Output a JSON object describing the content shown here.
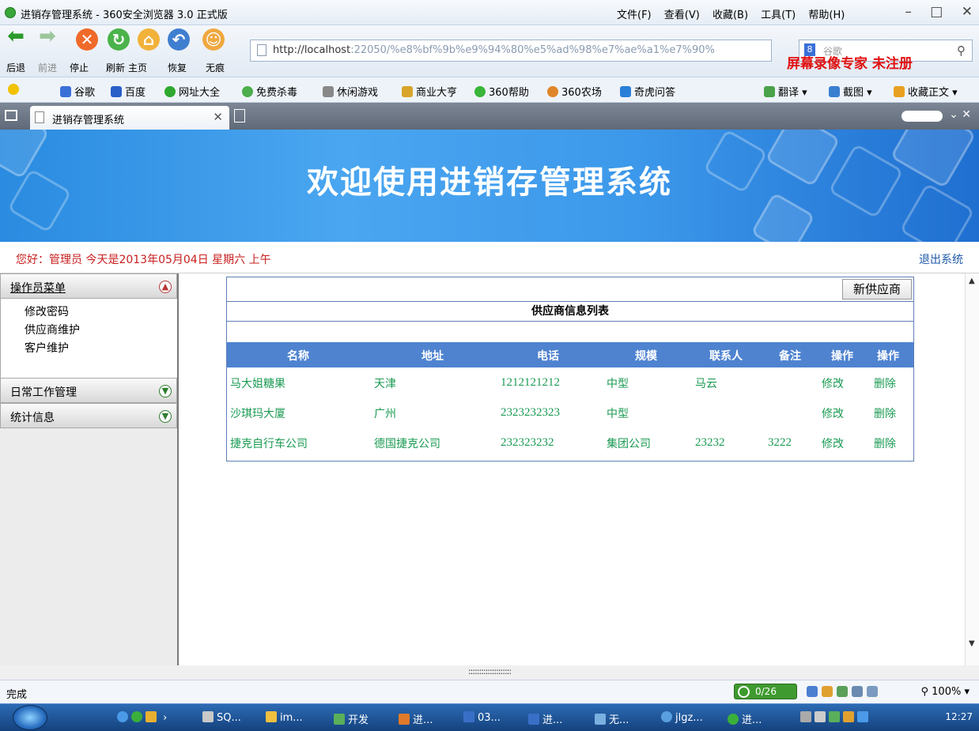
{
  "browser": {
    "window_title": "进销存管理系统 - 360安全浏览器 3.0 正式版",
    "menus": [
      "文件(F)",
      "查看(V)",
      "收藏(B)",
      "工具(T)",
      "帮助(H)"
    ],
    "nav_buttons": [
      "后退",
      "前进",
      "停止",
      "刷新",
      "主页",
      "恢复",
      "无痕"
    ],
    "address_host": "http://localhost",
    "address_rest": ":22050/%e8%bf%9b%e9%94%80%e5%ad%98%e7%ae%a1%e7%90%",
    "search_placeholder": "谷歌",
    "watermark": "屏幕录像专家  未注册",
    "favorites": [
      "谷歌",
      "百度",
      "网址大全",
      "免费杀毒",
      "休闲游戏",
      "商业大亨",
      "360帮助",
      "360农场",
      "奇虎问答"
    ],
    "toolbar_right": [
      "翻译",
      "截图",
      "收藏正文"
    ],
    "tab_title": "进销存管理系统",
    "status": "完成",
    "status_badge": "0/26",
    "zoom": "100%"
  },
  "page": {
    "banner_title": "欢迎使用进销存管理系统",
    "greeting": "您好：管理员   今天是2013年05月04日   星期六   上午",
    "logout": "退出系统"
  },
  "sidebar": {
    "sections": [
      {
        "title": "操作员菜单",
        "items": [
          "修改密码",
          "供应商维护",
          "客户维护"
        ]
      },
      {
        "title": "日常工作管理"
      },
      {
        "title": "统计信息"
      }
    ]
  },
  "panel": {
    "new_button": "新供应商",
    "title": "供应商信息列表",
    "columns": [
      "名称",
      "地址",
      "电话",
      "规模",
      "联系人",
      "备注",
      "操作",
      "操作"
    ],
    "rows": [
      [
        "马大姐糖果",
        "天津",
        "1212121212",
        "中型",
        "马云",
        "",
        "修改",
        "删除"
      ],
      [
        "沙琪玛大厦",
        "广州",
        "2323232323",
        "中型",
        "",
        "",
        "修改",
        "删除"
      ],
      [
        "捷克自行车公司",
        "德国捷克公司",
        "232323232",
        "集团公司",
        "23232",
        "3222",
        "修改",
        "删除"
      ]
    ]
  },
  "splitter": "::::::::::::::::::::",
  "taskbar": {
    "items": [
      "SQ...",
      "im...",
      "开发",
      "进...",
      "03...",
      "进...",
      "无...",
      "jlgz...",
      "进..."
    ],
    "clock": "12:27"
  },
  "colors": {
    "banner": "#3c98ea",
    "table_header": "#4f83d0",
    "link_green": "#1a9a52",
    "greeting_red": "#c81e1e"
  }
}
